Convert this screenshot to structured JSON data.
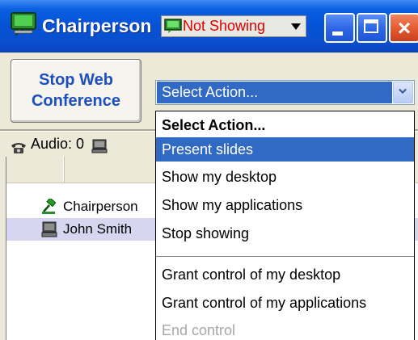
{
  "window": {
    "title": "Chairperson",
    "show_status": "Not Showing",
    "controls": {
      "minimize": "minimize",
      "maximize": "maximize",
      "close": "×"
    }
  },
  "toolbar": {
    "stop_button_label": "Stop Web\nConference",
    "action_select_value": "Select Action..."
  },
  "status": {
    "audio_label": "Audio: 0"
  },
  "participants": {
    "rows": [
      {
        "name": "Chairperson",
        "icon": "gavel-icon"
      },
      {
        "name": "John Smith",
        "icon": "computer-icon"
      }
    ]
  },
  "action_menu": {
    "items": [
      {
        "label": "Select Action...",
        "state": "header"
      },
      {
        "label": "Present slides",
        "state": "selected"
      },
      {
        "label": "Show my desktop",
        "state": "normal"
      },
      {
        "label": "Show my applications",
        "state": "normal"
      },
      {
        "label": "Stop showing",
        "state": "normal"
      },
      {
        "label": "Grant control of my desktop",
        "state": "normal"
      },
      {
        "label": "Grant control of my applications",
        "state": "normal"
      },
      {
        "label": "End control",
        "state": "disabled"
      }
    ]
  },
  "colors": {
    "titlebar": "#0652d6",
    "selection": "#316ac5",
    "stop_button_text": "#1d4fbf",
    "status_text": "#e00000",
    "row_highlight": "#d6d6f0"
  }
}
